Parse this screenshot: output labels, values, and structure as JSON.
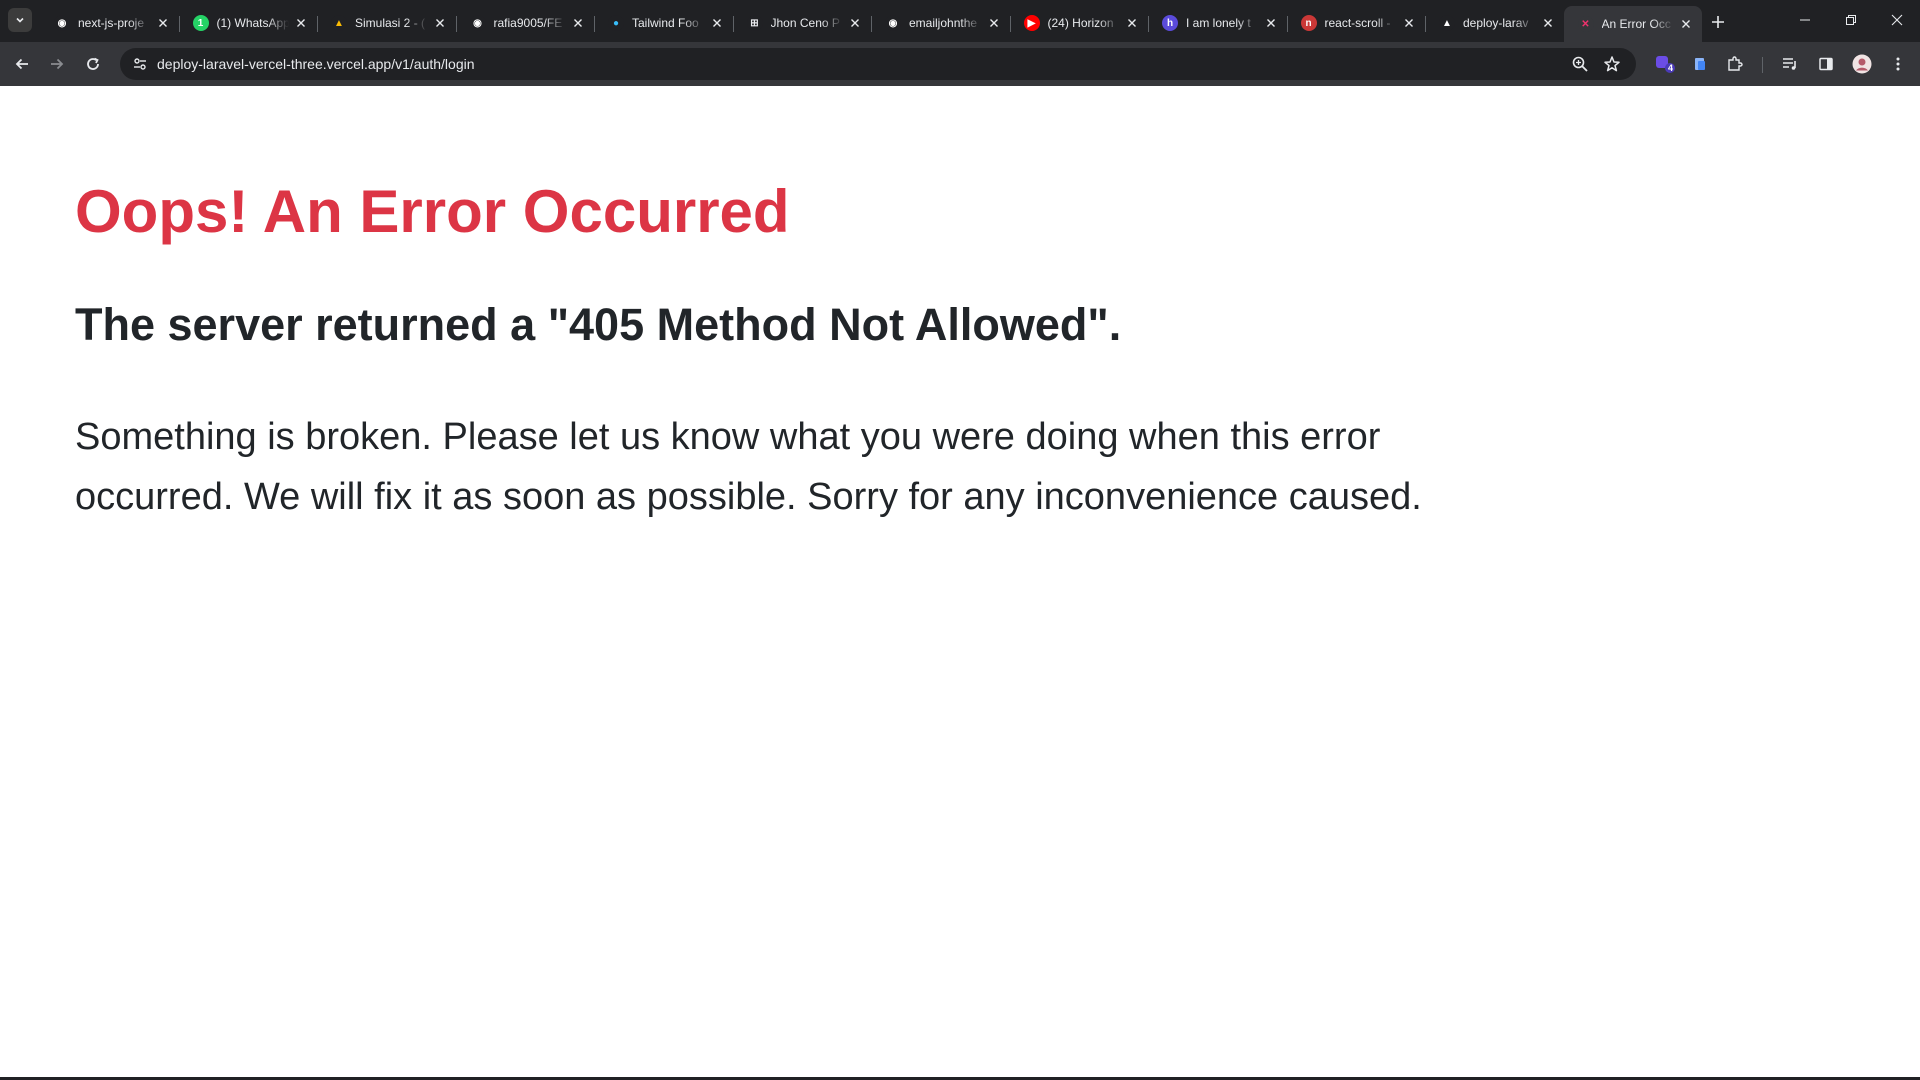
{
  "browser": {
    "tabs": [
      {
        "title": "next-js-proje",
        "icon": "github-icon",
        "fav_bg": "#202124",
        "fav_fg": "#ffffff",
        "glyph": "◉"
      },
      {
        "title": "(1) WhatsApp",
        "icon": "whatsapp-icon",
        "fav_bg": "#25d366",
        "fav_fg": "#ffffff",
        "glyph": "1"
      },
      {
        "title": "Simulasi 2 - (",
        "icon": "google-drive-icon",
        "fav_bg": "#202124",
        "fav_fg": "#fbbc04",
        "glyph": "▲"
      },
      {
        "title": "rafia9005/FE",
        "icon": "github-icon",
        "fav_bg": "#202124",
        "fav_fg": "#ffffff",
        "glyph": "◉"
      },
      {
        "title": "Tailwind Foo",
        "icon": "tailwind-icon",
        "fav_bg": "#202124",
        "fav_fg": "#38bdf8",
        "glyph": "●"
      },
      {
        "title": "Jhon Ceno P",
        "icon": "portfolio-icon",
        "fav_bg": "#202124",
        "fav_fg": "#e8eaed",
        "glyph": "⊞"
      },
      {
        "title": "emailjohnthe",
        "icon": "github-icon",
        "fav_bg": "#202124",
        "fav_fg": "#ffffff",
        "glyph": "◉"
      },
      {
        "title": "(24) Horizon",
        "icon": "youtube-icon",
        "fav_bg": "#ff0000",
        "fav_fg": "#ffffff",
        "glyph": "▶"
      },
      {
        "title": "I am lonely t",
        "icon": "bookmark-app-icon",
        "fav_bg": "#5b4bdb",
        "fav_fg": "#ffffff",
        "glyph": "h"
      },
      {
        "title": "react-scroll -",
        "icon": "npm-icon",
        "fav_bg": "#cb3837",
        "fav_fg": "#ffffff",
        "glyph": "n"
      },
      {
        "title": "deploy-larav",
        "icon": "vercel-icon",
        "fav_bg": "#202124",
        "fav_fg": "#ffffff",
        "glyph": "▲"
      },
      {
        "title": "An Error Occ",
        "icon": "error-x-icon",
        "fav_bg": "#35363a",
        "fav_fg": "#f0326e",
        "glyph": "✕",
        "active": true
      }
    ],
    "url": "deploy-laravel-vercel-three.vercel.app/v1/auth/login",
    "extension_badge": "4"
  },
  "page": {
    "title": "Oops! An Error Occurred",
    "subtitle": "The server returned a \"405 Method Not Allowed\".",
    "body": "Something is broken. Please let us know what you were doing when this error occurred. We will fix it as soon as possible. Sorry for any inconvenience caused."
  },
  "colors": {
    "error_title": "#dc3545",
    "text": "#212529",
    "chrome_dark": "#202124",
    "chrome_toolbar": "#35363a"
  }
}
